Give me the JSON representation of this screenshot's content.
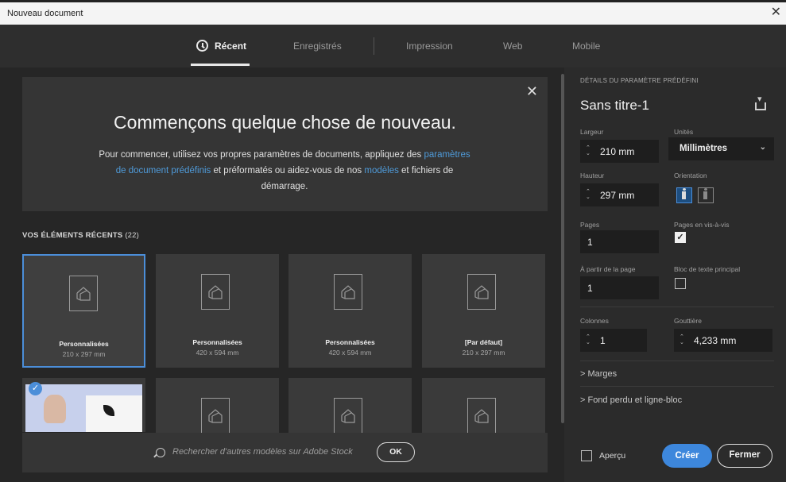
{
  "window": {
    "title": "Nouveau document",
    "close_glyph": "✕"
  },
  "tabs": [
    {
      "label": "Récent",
      "active": true,
      "icon": "clock-icon"
    },
    {
      "label": "Enregistrés"
    },
    {
      "label": "Impression"
    },
    {
      "label": "Web"
    },
    {
      "label": "Mobile"
    }
  ],
  "welcome": {
    "close_glyph": "✕",
    "heading": "Commençons quelque chose de nouveau.",
    "body_1": "Pour commencer, utilisez vos propres paramètres de documents, appliquez des ",
    "link_presets": "paramètres de document prédéfinis",
    "body_2": " et préformatés ou aidez-vous de nos ",
    "link_templates": "modèles",
    "body_3": " et fichiers de démarrage."
  },
  "recent": {
    "heading": "VOS ÉLÉMENTS RÉCENTS",
    "count": "(22)",
    "items": [
      {
        "name": "Personnalisées",
        "size": "210 x 297 mm",
        "selected": true
      },
      {
        "name": "Personnalisées",
        "size": "420 x 594 mm"
      },
      {
        "name": "Personnalisées",
        "size": "420 x 594 mm"
      },
      {
        "name": "[Par défaut]",
        "size": "210 x 297 mm"
      }
    ]
  },
  "search": {
    "placeholder": "Rechercher d'autres modèles sur Adobe Stock",
    "ok_label": "OK",
    "icon": "search-icon"
  },
  "details": {
    "header": "DÉTAILS DU PARAMÈTRE PRÉDÉFINI",
    "name": "Sans titre-1",
    "width_label": "Largeur",
    "width_value": "210 mm",
    "units_label": "Unités",
    "units_value": "Millimètres",
    "height_label": "Hauteur",
    "height_value": "297 mm",
    "orientation_label": "Orientation",
    "pages_label": "Pages",
    "pages_value": "1",
    "facing_label": "Pages en vis-à-vis",
    "facing_checked": true,
    "start_label": "À partir de la page",
    "start_value": "1",
    "primary_frame_label": "Bloc de texte principal",
    "primary_frame_checked": false,
    "columns_label": "Colonnes",
    "columns_value": "1",
    "gutter_label": "Gouttière",
    "gutter_value": "4,233 mm",
    "margins_label": "> Marges",
    "bleed_label": "> Fond perdu et ligne-bloc",
    "preview_label": "Aperçu",
    "create_label": "Créer",
    "close_label": "Fermer"
  },
  "colors": {
    "accent": "#3d87dc",
    "panel": "#2b2b2b",
    "main": "#262626"
  }
}
